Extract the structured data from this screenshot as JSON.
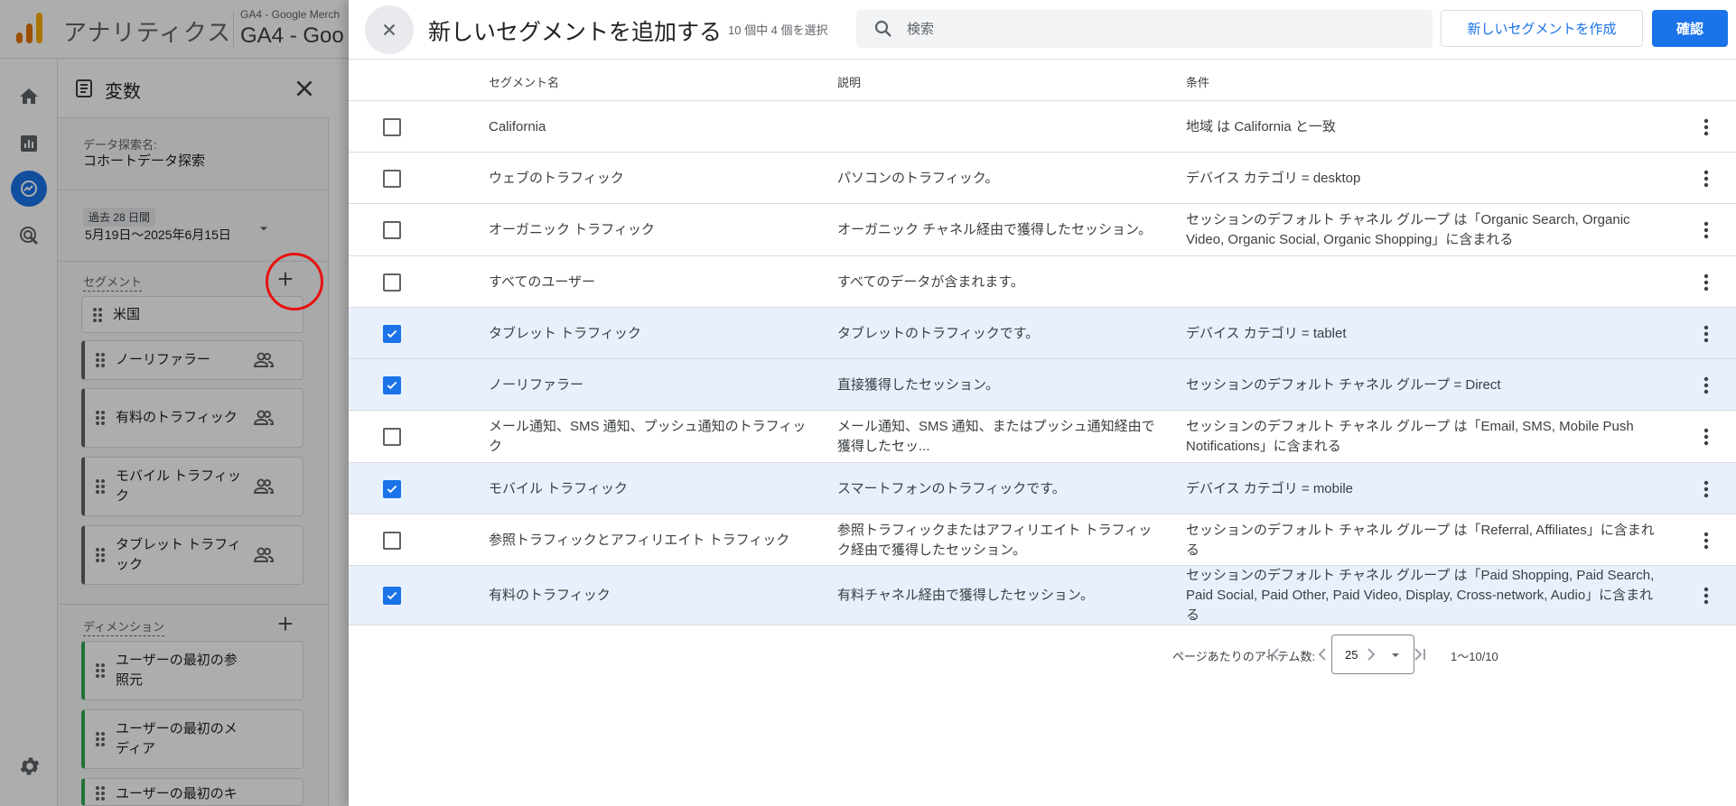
{
  "app": {
    "title": "アナリティクス",
    "property_account": "GA4 - Google Merch",
    "property_name": "GA4 - Goo"
  },
  "colors": {
    "accent": "#1a73e8",
    "selected_row": "#e8f0fe",
    "logo_orange": "#f9ab00",
    "logo_dark_orange": "#e37400",
    "dimension_green": "#34a853",
    "annotation_red": "#e8110f"
  },
  "rail": {
    "items": [
      {
        "name": "home-icon",
        "active": false
      },
      {
        "name": "reports-icon",
        "active": false
      },
      {
        "name": "explore-icon",
        "active": true
      },
      {
        "name": "advertising-icon",
        "active": false
      }
    ],
    "settings": "gear-icon"
  },
  "variables_panel": {
    "title": "変数",
    "exploration_name_label": "データ探索名:",
    "exploration_name_value": "コホートデータ探索",
    "date_chip": "過去 28 日間",
    "date_range": "5月19日～2025年6月15日",
    "segments_title": "セグメント",
    "segments": [
      {
        "label": "米国",
        "user_icon": false
      },
      {
        "label": "ノーリファラー",
        "user_icon": true
      },
      {
        "label": "有料のトラフィック",
        "user_icon": true
      },
      {
        "label": "モバイル トラフィック",
        "user_icon": true
      },
      {
        "label": "タブレット トラフィック",
        "user_icon": true
      }
    ],
    "dimensions_title": "ディメンション",
    "dimensions": [
      {
        "label": "ユーザーの最初の参照元"
      },
      {
        "label": "ユーザーの最初のメディア"
      },
      {
        "label": "ユーザーの最初のキャ"
      }
    ]
  },
  "dialog": {
    "title": "新しいセグメントを追加する",
    "selection_count": "10 個中 4 個を選択",
    "search_placeholder": "検索",
    "create_button": "新しいセグメントを作成",
    "confirm_button": "確認",
    "columns": {
      "name": "セグメント名",
      "description": "説明",
      "condition": "条件"
    },
    "rows": [
      {
        "checked": false,
        "name": "California",
        "description": "",
        "condition": "地域 は California と一致"
      },
      {
        "checked": false,
        "name": "ウェブのトラフィック",
        "description": "パソコンのトラフィック。",
        "condition": "デバイス カテゴリ = desktop"
      },
      {
        "checked": false,
        "name": "オーガニック トラフィック",
        "description": "オーガニック チャネル経由で獲得したセッション。",
        "condition": "セッションのデフォルト チャネル グループ は「Organic Search, Organic Video, Organic Social, Organic Shopping」に含まれる"
      },
      {
        "checked": false,
        "name": "すべてのユーザー",
        "description": "すべてのデータが含まれます。",
        "condition": ""
      },
      {
        "checked": true,
        "name": "タブレット トラフィック",
        "description": "タブレットのトラフィックです。",
        "condition": "デバイス カテゴリ = tablet"
      },
      {
        "checked": true,
        "name": "ノーリファラー",
        "description": "直接獲得したセッション。",
        "condition": "セッションのデフォルト チャネル グループ = Direct"
      },
      {
        "checked": false,
        "name": "メール通知、SMS 通知、プッシュ通知のトラフィック",
        "description": "メール通知、SMS 通知、またはプッシュ通知経由で獲得したセッ...",
        "condition": "セッションのデフォルト チャネル グループ は「Email, SMS, Mobile Push Notifications」に含まれる"
      },
      {
        "checked": true,
        "name": "モバイル トラフィック",
        "description": "スマートフォンのトラフィックです。",
        "condition": "デバイス カテゴリ = mobile"
      },
      {
        "checked": false,
        "name": "参照トラフィックとアフィリエイト トラフィック",
        "description": "参照トラフィックまたはアフィリエイト トラフィック経由で獲得したセッション。",
        "condition": "セッションのデフォルト チャネル グループ は「Referral, Affiliates」に含まれる"
      },
      {
        "checked": true,
        "name": "有料のトラフィック",
        "description": "有料チャネル経由で獲得したセッション。",
        "condition": "セッションのデフォルト チャネル グループ は「Paid Shopping, Paid Search, Paid Social, Paid Other, Paid Video, Display, Cross-network, Audio」に含まれる"
      }
    ],
    "pagination": {
      "items_per_page_label": "ページあたりのアイテム数:",
      "items_per_page_value": "25",
      "range": "1～10/10"
    }
  }
}
